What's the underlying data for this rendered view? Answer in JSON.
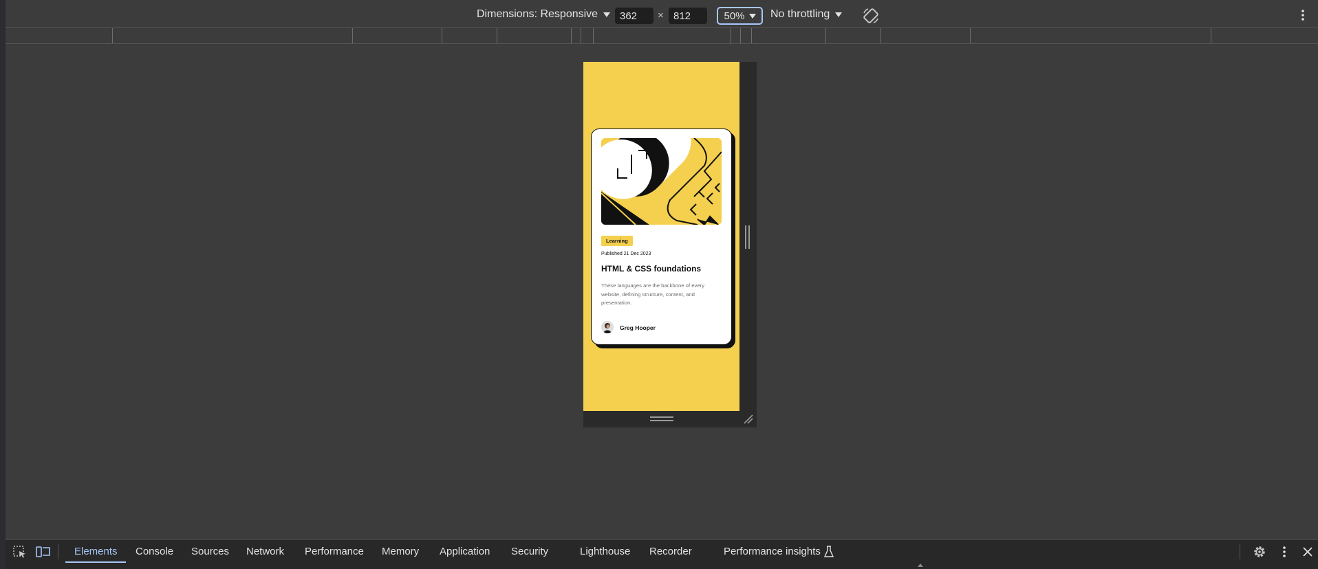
{
  "device_toolbar": {
    "dimensions_label": "Dimensions: Responsive",
    "width_value": "362",
    "times_symbol": "×",
    "height_value": "812",
    "zoom_label": "50%",
    "throttling_label": "No throttling",
    "rotate_icon": "rotate-icon",
    "more_icon": "more-vertical-icon"
  },
  "card": {
    "tag": "Learning",
    "date": "Published 21 Dec 2023",
    "title": "HTML & CSS foundations",
    "description": "These languages are the backbone of every website, defining structure, content, and presentation.",
    "author": "Greg Hooper",
    "accent_color": "#f4d04e"
  },
  "bottom_panel": {
    "inspect_icon": "inspect-element-icon",
    "device_icon": "device-toolbar-icon",
    "tabs": [
      {
        "label": "Elements"
      },
      {
        "label": "Console"
      },
      {
        "label": "Sources"
      },
      {
        "label": "Network"
      },
      {
        "label": "Performance"
      },
      {
        "label": "Memory"
      },
      {
        "label": "Application"
      },
      {
        "label": "Security"
      },
      {
        "label": "Lighthouse"
      },
      {
        "label": "Recorder"
      },
      {
        "label": "Performance insights"
      }
    ],
    "active_tab": "Elements",
    "active_color": "#a8c7fa",
    "settings_icon": "gear-icon",
    "more_icon": "more-vertical-icon",
    "close_icon": "close-icon"
  }
}
